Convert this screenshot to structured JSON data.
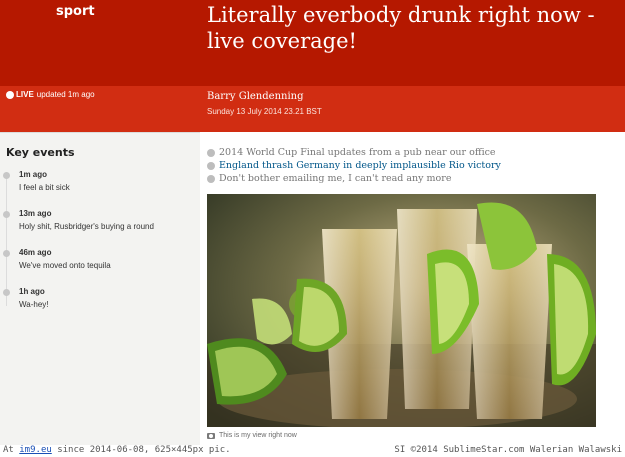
{
  "header": {
    "section": "sport",
    "headline": "Literally everbody drunk right now - live coverage!"
  },
  "meta": {
    "live_label": "LIVE",
    "updated": "updated 1m ago",
    "author": "Barry Glendenning",
    "date": "Sunday 13 July 2014 23.21 BST"
  },
  "key_events": {
    "title": "Key events",
    "items": [
      {
        "time": "1m ago",
        "text": "I feel a bit sick"
      },
      {
        "time": "13m ago",
        "text": "Holy shit, Rusbridger's buying a round"
      },
      {
        "time": "46m ago",
        "text": "We've moved onto tequila"
      },
      {
        "time": "1h ago",
        "text": "Wa-hey!"
      }
    ]
  },
  "bullets": [
    "2014 World Cup Final updates from a pub near our office",
    "England thrash Germany in deeply implausible Rio victory",
    "Don't bother emailing me, I can't read any more"
  ],
  "photo": {
    "caption": "This is my view right now"
  },
  "footer": {
    "prefix": "At",
    "site": "im9.eu",
    "suffix": "since 2014-06-08, 625×445px pic.",
    "right": "SI ©2014 SublimeStar.com Walerian Walawski"
  },
  "colors": {
    "header_bg": "#b51800",
    "bar_bg": "#d12d12",
    "link": "#005689"
  }
}
